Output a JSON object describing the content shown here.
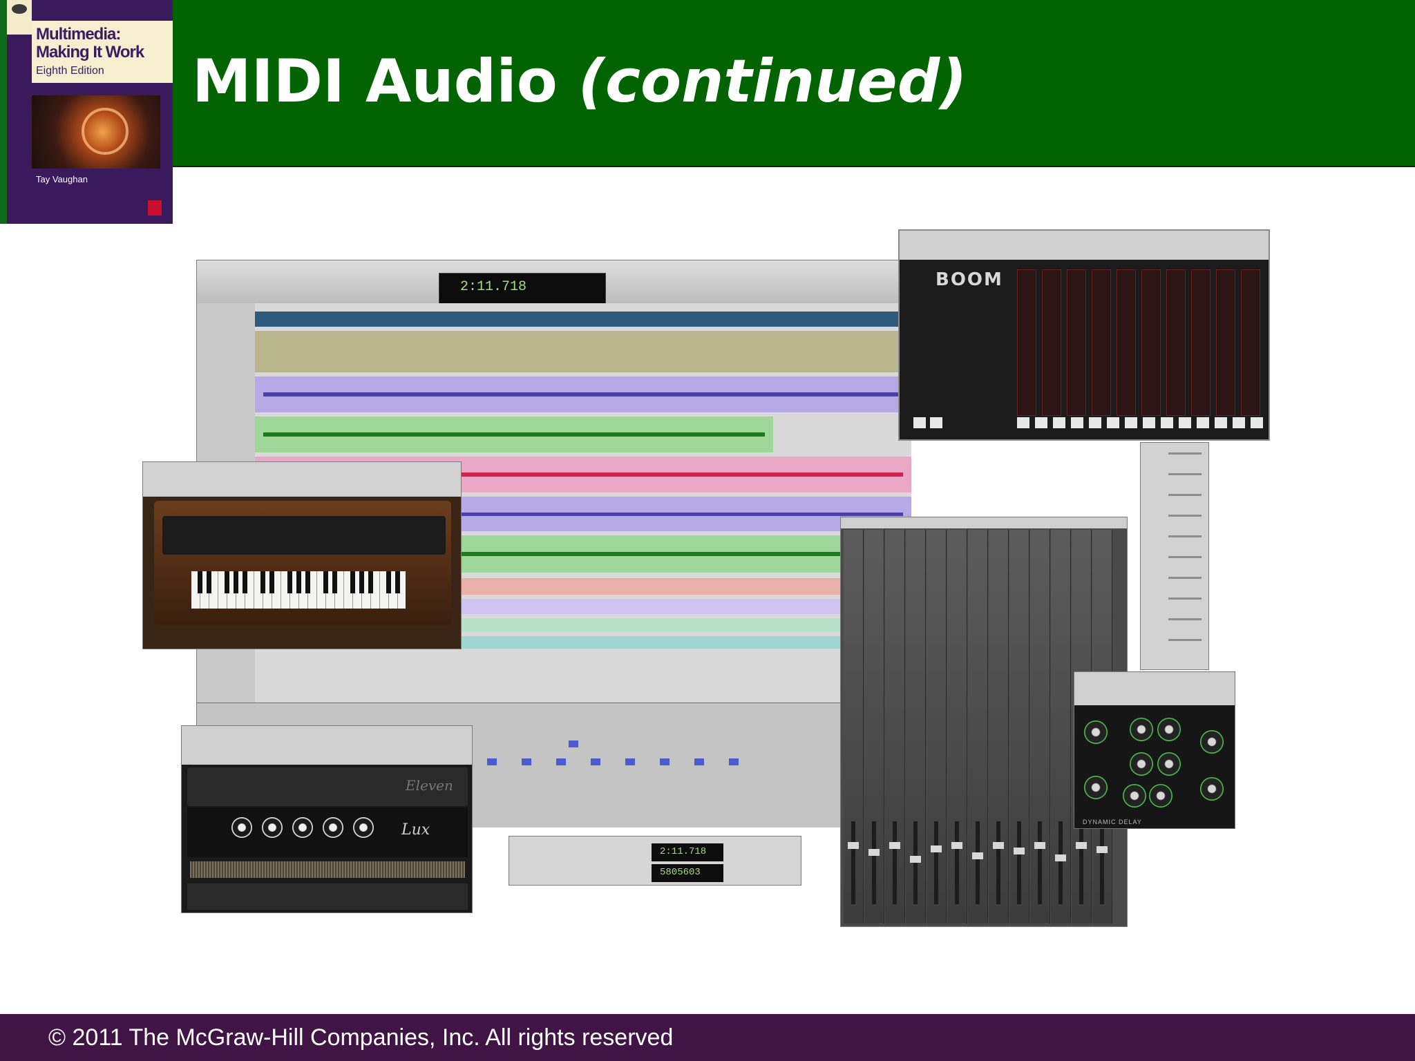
{
  "slide": {
    "title_main": "MIDI Audio ",
    "title_italic": "(continued)"
  },
  "book_cover": {
    "title_line1": "Multimedia:",
    "title_line2": "Making It Work",
    "edition": "Eighth Edition",
    "author": "Tay Vaughan"
  },
  "screenshot": {
    "main_counter": "2:11.718",
    "boom_logo": "BOOM",
    "amp_brand": "Lux",
    "organ_brand": "Eleven",
    "delay_label": "DYNAMIC DELAY",
    "transport_counter_1": "2:11.718",
    "transport_counter_2": "5805603"
  },
  "footer": {
    "copyright": "© 2011 The McGraw-Hill Companies, Inc. All rights reserved"
  },
  "colors": {
    "header_bg": "#016400",
    "footer_bg": "#401546",
    "title_text": "#ffffff"
  }
}
